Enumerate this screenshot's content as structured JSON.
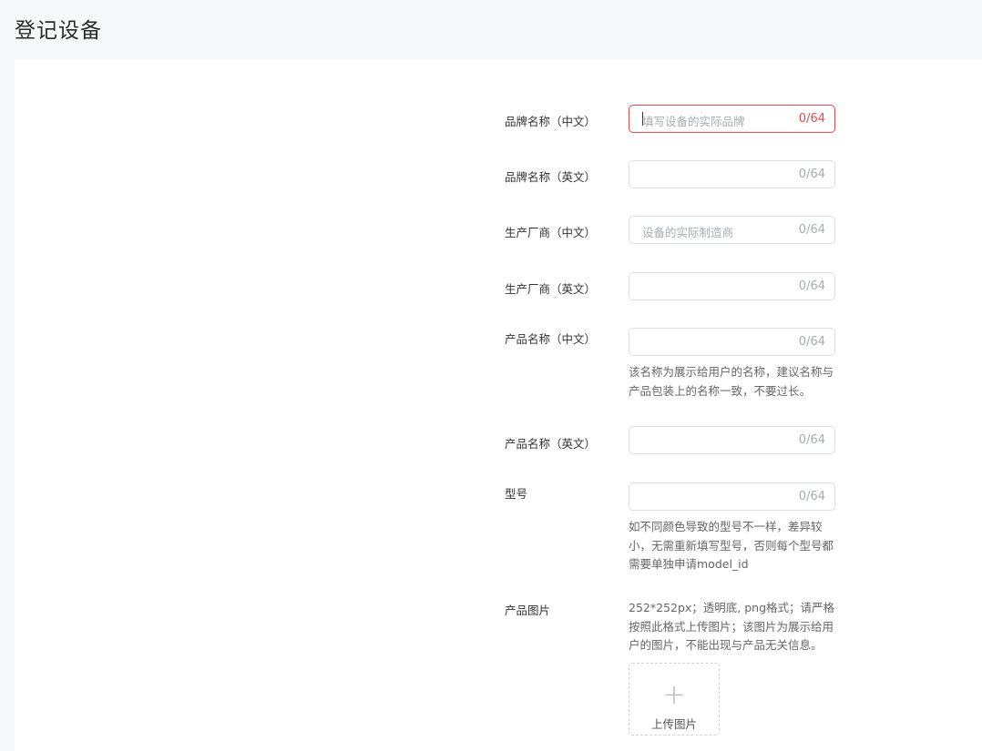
{
  "page": {
    "title": "登记设备"
  },
  "form": {
    "brand_cn": {
      "label": "品牌名称（中文）",
      "placeholder": "填写设备的实际品牌",
      "count": "0/64"
    },
    "brand_en": {
      "label": "品牌名称（英文）",
      "placeholder": "",
      "count": "0/64"
    },
    "manufacturer_cn": {
      "label": "生产厂商（中文）",
      "placeholder": "设备的实际制造商",
      "count": "0/64"
    },
    "manufacturer_en": {
      "label": "生产厂商（英文）",
      "placeholder": "",
      "count": "0/64"
    },
    "product_name_cn": {
      "label": "产品名称（中文）",
      "placeholder": "",
      "count": "0/64",
      "help_line1": "该名称为展示给用户的名称，建议名称与",
      "help_line2": "产品包装上的名称一致，不要过长。"
    },
    "product_name_en": {
      "label": "产品名称（英文）",
      "placeholder": "",
      "count": "0/64"
    },
    "model": {
      "label": "型号",
      "placeholder": "",
      "count": "0/64",
      "help_line1": "如不同颜色导致的型号不一样，差异较",
      "help_line2": "小，无需重新填写型号，否则每个型号都",
      "help_line3": "需要单独申请model_id"
    },
    "product_image": {
      "label": "产品图片",
      "help_line1": "252*252px；透明底, png格式；请严格",
      "help_line2": "按照此格式上传图片；该图片为展示给用",
      "help_line3": "户的图片，不能出现与产品无关信息。",
      "upload_icon": "plus-icon",
      "upload_label": "上传图片"
    }
  },
  "colors": {
    "error": "#e5484d",
    "border": "#dcdfe6",
    "placeholder": "#a8abb2"
  }
}
